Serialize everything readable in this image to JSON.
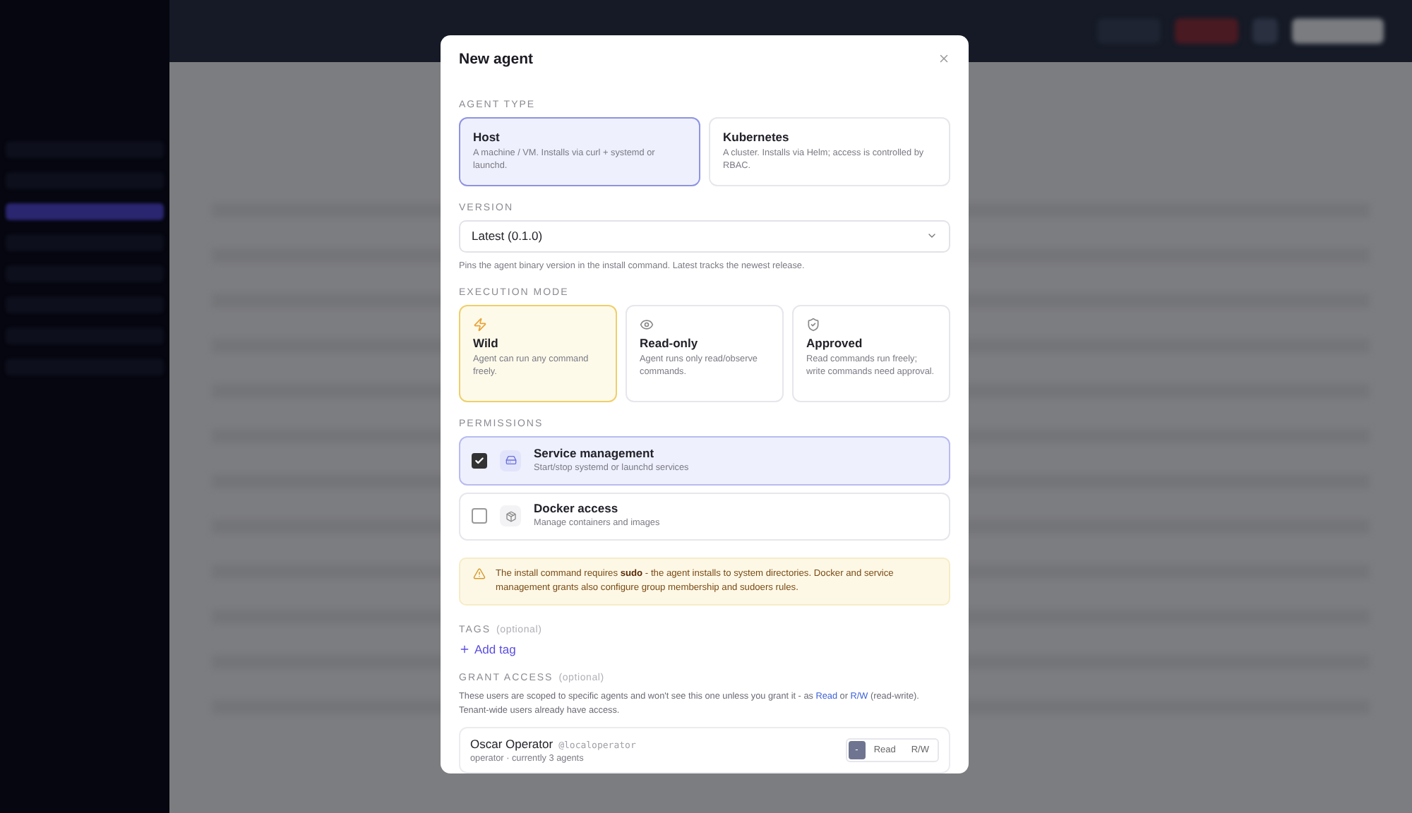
{
  "modal": {
    "title": "New agent",
    "agent_type": {
      "label": "AGENT TYPE",
      "options": [
        {
          "title": "Host",
          "description": "A machine / VM. Installs via curl + systemd or launchd.",
          "selected": true
        },
        {
          "title": "Kubernetes",
          "description": "A cluster. Installs via Helm; access is controlled by RBAC.",
          "selected": false
        }
      ]
    },
    "version": {
      "label": "VERSION",
      "value": "Latest (0.1.0)",
      "hint": "Pins the agent binary version in the install command. Latest tracks the newest release."
    },
    "execution_mode": {
      "label": "EXECUTION MODE",
      "options": [
        {
          "kind": "bolt",
          "title": "Wild",
          "description": "Agent can run any command freely.",
          "selected": true
        },
        {
          "kind": "eye",
          "title": "Read-only",
          "description": "Agent runs only read/observe commands.",
          "selected": false
        },
        {
          "kind": "shield",
          "title": "Approved",
          "description": "Read commands run freely; write commands need approval.",
          "selected": false
        }
      ]
    },
    "permissions": {
      "label": "PERMISSIONS",
      "items": [
        {
          "kind": "server",
          "title": "Service management",
          "description": "Start/stop systemd or launchd services",
          "checked": true
        },
        {
          "kind": "package",
          "title": "Docker access",
          "description": "Manage containers and images",
          "checked": false
        }
      ]
    },
    "warning": "The install command requires **sudo** - the agent installs to system directories. Docker and service management grants also configure group membership and sudoers rules.",
    "tags": {
      "label": "TAGS",
      "note": "(optional)",
      "add": "Add tag"
    },
    "grant_access": {
      "label": "GRANT ACCESS",
      "note": "(optional)",
      "text_before": "These users are scoped to specific agents and won't see this one unless you grant it - as",
      "read_link": "Read",
      "text_middle": "or",
      "rw_link": "R/W",
      "text_after": "(read-write). Tenant-wide users already have access.",
      "users": [
        {
          "name": "Oscar Operator",
          "handle": "@localoperator",
          "meta": "operator · currently 3 agents",
          "access": [
            {
              "label": "-",
              "selected": true
            },
            {
              "label": "Read",
              "selected": false
            },
            {
              "label": "R/W",
              "selected": false
            }
          ]
        }
      ]
    }
  }
}
